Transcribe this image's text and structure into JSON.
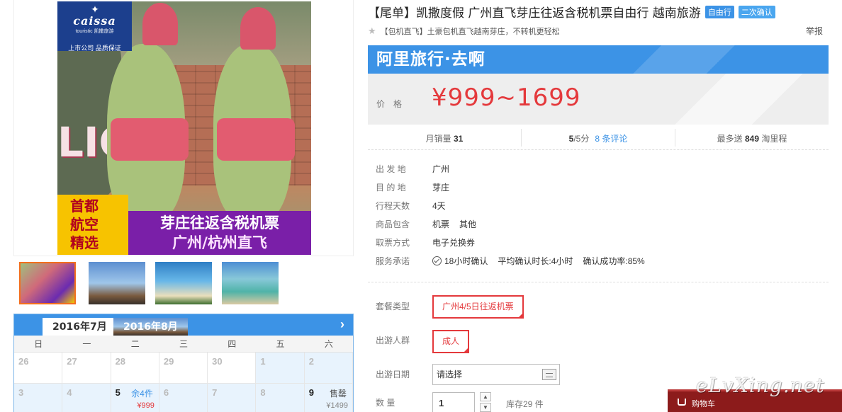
{
  "product": {
    "brand_logo": "caissa",
    "brand_sub": "touristic 凯撒旅游",
    "brand_tag": "上市公司 品质保证",
    "sign_text": "LIOL",
    "banner_left": [
      "首都",
      "航空",
      "精选"
    ],
    "banner_right": [
      "芽庄往返含税机票",
      "广州/杭州直飞"
    ]
  },
  "calendar": {
    "tabs": [
      "2016年7月",
      "2016年8月"
    ],
    "next_icon": "chevron-right-icon",
    "weekdays": [
      "日",
      "一",
      "二",
      "三",
      "四",
      "五",
      "六"
    ],
    "row1": [
      {
        "day": "26"
      },
      {
        "day": "27"
      },
      {
        "day": "28"
      },
      {
        "day": "29"
      },
      {
        "day": "30"
      },
      {
        "day": "1"
      },
      {
        "day": "2"
      }
    ],
    "row2": [
      {
        "day": "3"
      },
      {
        "day": "4"
      },
      {
        "day": "5",
        "rest": "余4件",
        "price": "¥999"
      },
      {
        "day": "6"
      },
      {
        "day": "7"
      },
      {
        "day": "8"
      },
      {
        "day": "9",
        "rest": "售罄",
        "price": "¥1499"
      }
    ]
  },
  "info": {
    "title": "【尾单】凯撒度假 广州直飞芽庄往返含税机票自由行 越南旅游",
    "tags": [
      "自由行",
      "二次确认"
    ],
    "subline": "【包机直飞】土豪包机直飞越南芽庄，不转机更轻松",
    "report": "举报",
    "ali_brand": "阿里旅行·去啊",
    "price_label": "价格",
    "price": "¥999~1699",
    "monthly_label": "月销量",
    "monthly": "31",
    "score": "5",
    "score_suffix": "/5分",
    "reviews": "8 条评论",
    "miles_prefix": "最多送",
    "miles": "849",
    "miles_suffix": "淘里程"
  },
  "attributes": {
    "departure_label": "出 发 地",
    "departure": "广州",
    "destination_label": "目 的 地",
    "destination": "芽庄",
    "days_label": "行程天数",
    "days": "4天",
    "includes_label": "商品包含",
    "includes": [
      "机票",
      "其他"
    ],
    "ticket_label": "取票方式",
    "ticket": "电子兑换券",
    "service_label": "服务承诺",
    "service": [
      "18小时确认",
      "平均确认时长:4小时",
      "确认成功率:85%"
    ]
  },
  "options": {
    "package_label": "套餐类型",
    "package": "广州4/5日往返机票",
    "people_label": "出游人群",
    "people": "成人",
    "date_label": "出游日期",
    "date_placeholder": "请选择",
    "qty_label": "数 量",
    "qty": "1",
    "stock": "库存29 件"
  },
  "cart": {
    "label": "购物车"
  },
  "watermark": "eLvXing.net"
}
